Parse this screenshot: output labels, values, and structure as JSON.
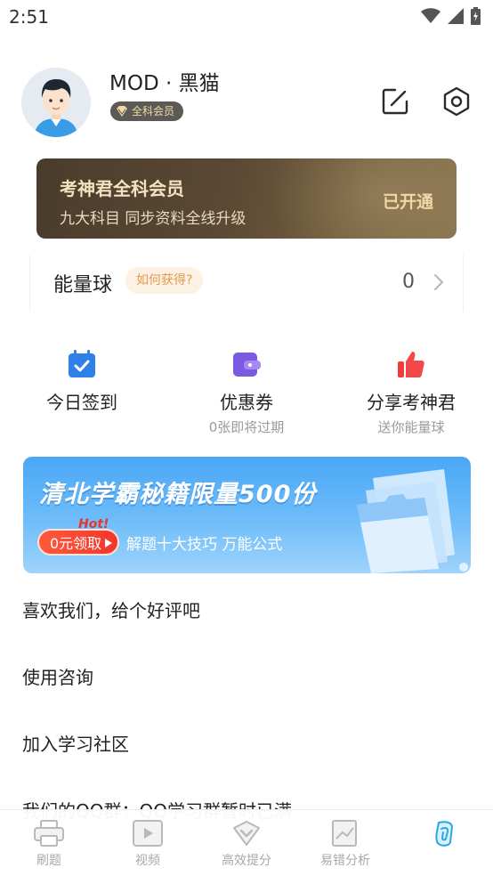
{
  "status_bar": {
    "time": "2:51",
    "icons": [
      "wifi-icon",
      "signal-icon",
      "battery-charging-icon"
    ]
  },
  "profile": {
    "name": "MOD · 黑猫",
    "badge": "全科会员",
    "actions": [
      "edit-icon",
      "settings-icon"
    ]
  },
  "vip_card": {
    "title": "考神君全科会员",
    "subtitle": "九大科目 同步资料全线升级",
    "status": "已开通"
  },
  "energy": {
    "label": "能量球",
    "how_to_get": "如何获得?",
    "value": "0"
  },
  "quick_actions": [
    {
      "icon": "calendar-check-icon",
      "label": "今日签到",
      "sub": ""
    },
    {
      "icon": "wallet-icon",
      "label": "优惠券",
      "sub": "0张即将过期"
    },
    {
      "icon": "thumbs-up-icon",
      "label": "分享考神君",
      "sub": "送你能量球"
    }
  ],
  "banner": {
    "title": "清北学霸秘籍限量500份",
    "hot": "Hot!",
    "cta": "0元领取",
    "desc": "解题十大技巧 万能公式"
  },
  "menu": [
    "喜欢我们，给个好评吧",
    "使用咨询",
    "加入学习社区",
    "我们的QQ群：QQ学习群暂时已满"
  ],
  "tabs": [
    {
      "label": "刷题",
      "icon": "printer-icon",
      "active": false
    },
    {
      "label": "视频",
      "icon": "video-icon",
      "active": false
    },
    {
      "label": "高效提分",
      "icon": "shield-check-icon",
      "active": false
    },
    {
      "label": "易错分析",
      "icon": "chart-icon",
      "active": false
    },
    {
      "label": "",
      "icon": "profile-icon",
      "active": true
    }
  ],
  "colors": {
    "accent": "#2aa7e0",
    "vip_gold": "#f0d8a6",
    "energy_tag": "#e39a4e",
    "banner_cta": "#f2362c"
  }
}
